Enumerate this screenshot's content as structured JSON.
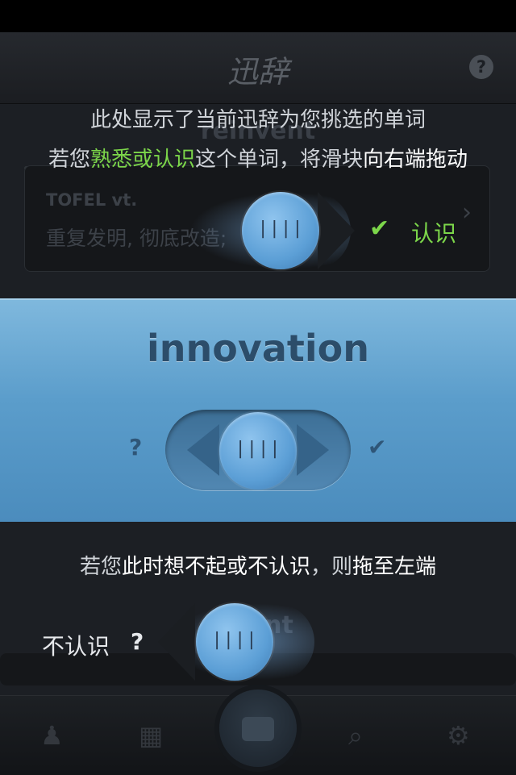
{
  "navbar": {
    "logo": "迅辞",
    "help": "?"
  },
  "background": {
    "word_top": "reinvent",
    "card_phonetic": "TOFEL vt.",
    "card_definition": "重复发明, 彻底改造;  ",
    "word_bottom": "giant"
  },
  "tutorial_top": {
    "line1": "此处显示了当前迅辞为您挑选的单词",
    "line2_a": "若您",
    "line2_b": "熟悉或认识",
    "line2_c": "这个单词，将滑块",
    "line2_d": "向右端拖动",
    "slider_grip": "||||",
    "confirm_icon": "✔",
    "confirm_label": "认识"
  },
  "main_card": {
    "word": "innovation",
    "left_hint": "?",
    "right_hint": "✔",
    "slider_grip": "||||"
  },
  "tutorial_bottom": {
    "text_a": "若您",
    "text_b": "此时想不起或不认识",
    "text_c": "，则",
    "text_d": "拖至左端",
    "unknown_label": "不认识",
    "unknown_icon": "?",
    "slider_grip": "||||"
  },
  "tabbar": {
    "items": [
      "profile-icon",
      "grid-icon",
      "center-button",
      "search-icon",
      "settings-icon"
    ]
  }
}
